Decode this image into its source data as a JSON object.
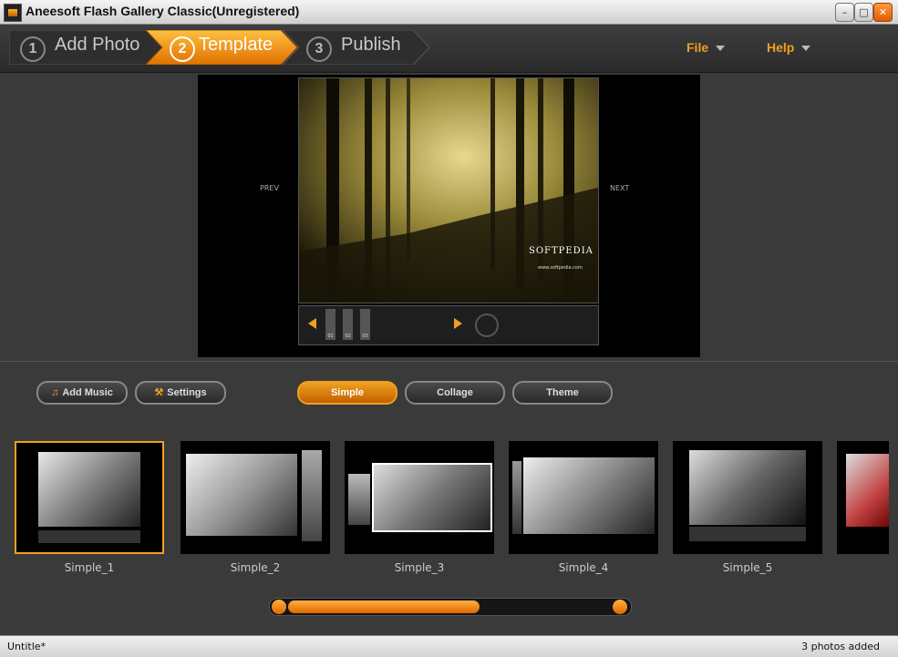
{
  "window": {
    "title": "Aneesoft Flash Gallery Classic(Unregistered)"
  },
  "steps": [
    {
      "num": "1",
      "label": "Add Photo"
    },
    {
      "num": "2",
      "label": "Template"
    },
    {
      "num": "3",
      "label": "Publish"
    }
  ],
  "menus": {
    "file": "File",
    "help": "Help"
  },
  "preview": {
    "prev": "PREV",
    "next": "NEXT",
    "watermark": "SOFTPEDIA",
    "url": "www.softpedia.com",
    "thumbs": [
      "01",
      "02",
      "03"
    ]
  },
  "controls": {
    "add_music": "Add Music",
    "settings": "Settings",
    "tabs": [
      "Simple",
      "Collage",
      "Theme"
    ]
  },
  "templates": [
    "Simple_1",
    "Simple_2",
    "Simple_3",
    "Simple_4",
    "Simple_5"
  ],
  "status": {
    "left": "Untitle*",
    "right": "3 photos added"
  },
  "colors": {
    "accent": "#f0a020"
  }
}
